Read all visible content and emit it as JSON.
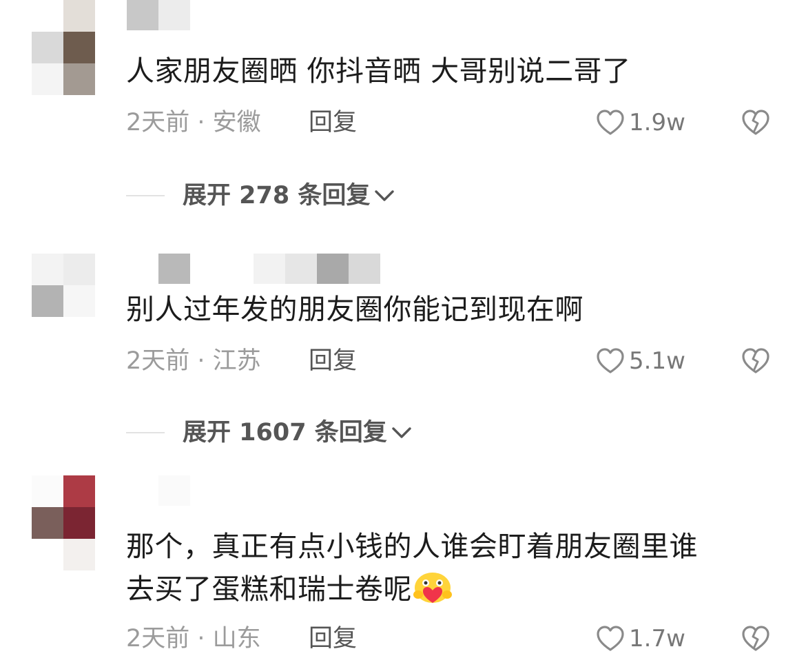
{
  "comments": [
    {
      "text": "人家朋友圈晒 你抖音晒 大哥别说二哥了",
      "time_location": "2天前 · 安徽",
      "reply_label": "回复",
      "likes": "1.9w",
      "expand_label": "展开 278 条回复"
    },
    {
      "text": "别人过年发的朋友圈你能记到现在啊",
      "time_location": "2天前 · 江苏",
      "reply_label": "回复",
      "likes": "5.1w",
      "expand_label": "展开 1607 条回复"
    },
    {
      "text_line1": "那个，真正有点小钱的人谁会盯着朋友圈里谁",
      "text_line2": "去买了蛋糕和瑞士卷呢",
      "time_location": "2天前 · 山东",
      "reply_label": "回复",
      "likes": "1.7w"
    }
  ],
  "icons": {
    "like": "heart-outline-icon",
    "dislike": "broken-heart-icon",
    "expand": "chevron-down-icon",
    "emoji": "heart-hug-emoji"
  },
  "colors": {
    "text": "#1c1c1c",
    "meta": "#9b9b9b",
    "reply": "#555555",
    "icon": "#8a8a8a"
  }
}
